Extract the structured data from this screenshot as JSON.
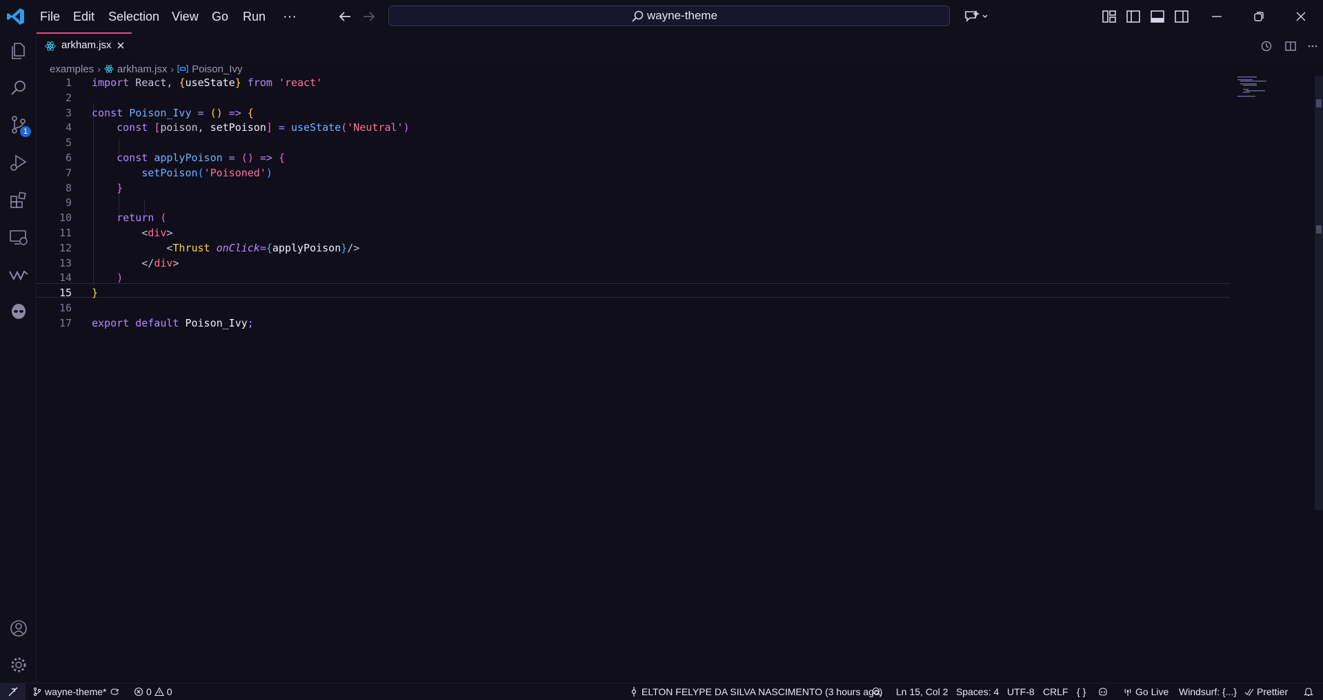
{
  "title_bar": {
    "menu": [
      "File",
      "Edit",
      "Selection",
      "View",
      "Go",
      "Run"
    ],
    "more_label": "···",
    "search_text": "wayne-theme"
  },
  "tab": {
    "label": "arkham.jsx"
  },
  "breadcrumb": {
    "folder": "examples",
    "file": "arkham.jsx",
    "symbol": "Poison_Ivy"
  },
  "activity_bar": {
    "scm_badge": "1"
  },
  "editor": {
    "line_numbers": [
      "1",
      "2",
      "3",
      "4",
      "5",
      "6",
      "7",
      "8",
      "9",
      "10",
      "11",
      "12",
      "13",
      "14",
      "15",
      "16",
      "17"
    ],
    "active_line": "15",
    "lines": [
      [
        [
          "kw",
          "import"
        ],
        [
          "pl",
          " React, "
        ],
        [
          "br1",
          "{"
        ],
        [
          "wh",
          "useState"
        ],
        [
          "br1",
          "}"
        ],
        [
          "kw",
          " from "
        ],
        [
          "st",
          "'react'"
        ]
      ],
      [],
      [
        [
          "kw",
          "const "
        ],
        [
          "fn",
          "Poison_Ivy"
        ],
        [
          "op",
          " = "
        ],
        [
          "br1",
          "()"
        ],
        [
          "op",
          " => "
        ],
        [
          "br1",
          "{"
        ]
      ],
      [
        [
          "pl",
          "    "
        ],
        [
          "kw",
          "const "
        ],
        [
          "br2",
          "["
        ],
        [
          "pl",
          "poison, "
        ],
        [
          "wh",
          "setPoison"
        ],
        [
          "br2",
          "]"
        ],
        [
          "op",
          " = "
        ],
        [
          "fn",
          "useState"
        ],
        [
          "br2",
          "("
        ],
        [
          "st",
          "'Neutral'"
        ],
        [
          "br2",
          ")"
        ]
      ],
      [],
      [
        [
          "pl",
          "    "
        ],
        [
          "kw",
          "const "
        ],
        [
          "fn",
          "applyPoison"
        ],
        [
          "op",
          " = "
        ],
        [
          "br2",
          "()"
        ],
        [
          "op",
          " => "
        ],
        [
          "br2",
          "{"
        ]
      ],
      [
        [
          "pl",
          "        "
        ],
        [
          "fn",
          "setPoison"
        ],
        [
          "br3",
          "("
        ],
        [
          "st",
          "'Poisoned'"
        ],
        [
          "br3",
          ")"
        ]
      ],
      [
        [
          "pl",
          "    "
        ],
        [
          "br2",
          "}"
        ]
      ],
      [],
      [
        [
          "pl",
          "    "
        ],
        [
          "kw",
          "return "
        ],
        [
          "br2",
          "("
        ]
      ],
      [
        [
          "pl",
          "        "
        ],
        [
          "pl",
          "<"
        ],
        [
          "tag",
          "div"
        ],
        [
          "pl",
          ">"
        ]
      ],
      [
        [
          "pl",
          "            "
        ],
        [
          "pl",
          "<"
        ],
        [
          "comp",
          "Thrust"
        ],
        [
          "attr",
          " onClick"
        ],
        [
          "op",
          "="
        ],
        [
          "br3",
          "{"
        ],
        [
          "wh",
          "applyPoison"
        ],
        [
          "br3",
          "}"
        ],
        [
          "pl",
          "/>"
        ]
      ],
      [
        [
          "pl",
          "        "
        ],
        [
          "pl",
          "</"
        ],
        [
          "tag",
          "div"
        ],
        [
          "pl",
          ">"
        ]
      ],
      [
        [
          "pl",
          "    "
        ],
        [
          "br2",
          ")"
        ]
      ],
      [
        [
          "br1",
          "}"
        ]
      ],
      [],
      [
        [
          "kw",
          "export default "
        ],
        [
          "wh",
          "Poison_Ivy"
        ],
        [
          "op",
          ";"
        ]
      ]
    ]
  },
  "status_bar": {
    "branch": "wayne-theme*",
    "errors": "0",
    "warnings": "0",
    "blame": "ELTON FELYPE DA SILVA NASCIMENTO (3 hours ago)",
    "position": "Ln 15, Col 2",
    "spaces": "Spaces: 4",
    "encoding": "UTF-8",
    "eol": "CRLF",
    "language": "{ }",
    "go_live": "Go Live",
    "windsurf": "Windsurf: {...}",
    "prettier": "Prettier"
  },
  "colors": {
    "background": "#0f0e1a",
    "keyword": "#b08cff",
    "function": "#6fb3ff",
    "string": "#ff6fa0",
    "bracket_gold": "#ffd04d",
    "bracket_pink": "#e36bd6",
    "tab_accent": "#e34c93",
    "badge": "#1b6ad8"
  },
  "icons": {
    "title_bar": [
      "vscode-logo-icon",
      "back-arrow-icon",
      "forward-arrow-icon",
      "search-icon",
      "copilot-icon",
      "customize-layout-icon",
      "toggle-primary-sidebar-icon",
      "toggle-panel-icon",
      "toggle-secondary-sidebar-icon",
      "minimize-icon",
      "restore-icon",
      "close-window-icon"
    ],
    "activity_bar": [
      "explorer-icon",
      "search-icon",
      "source-control-icon",
      "run-debug-icon",
      "extensions-icon",
      "remote-explorer-icon",
      "windsurf-icon",
      "alien-icon",
      "account-icon",
      "settings-gear-icon"
    ]
  }
}
